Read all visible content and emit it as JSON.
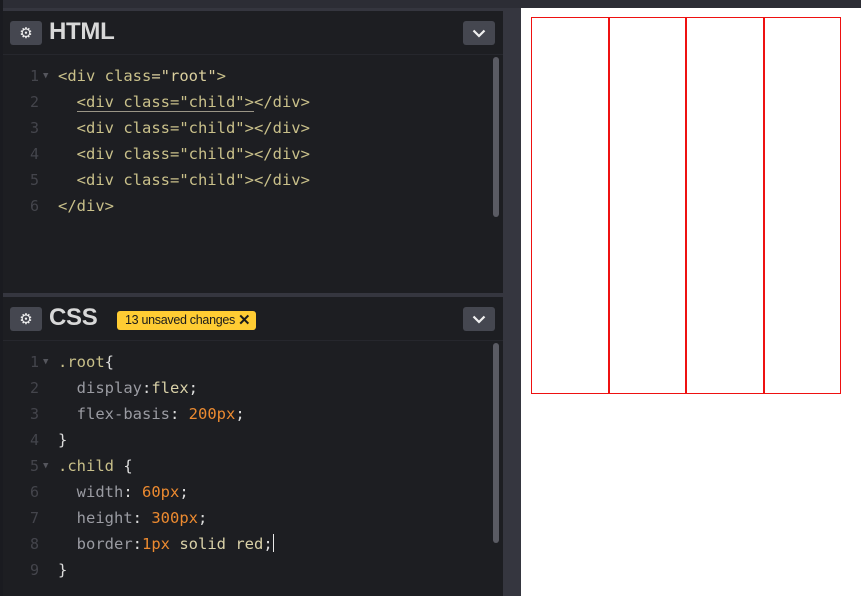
{
  "html_panel": {
    "title": "HTML",
    "settings_icon": "gear-icon",
    "collapse_icon": "chevron-down-icon",
    "lines": [
      {
        "n": "1",
        "tokens": [
          {
            "t": "<div ",
            "c": "t-tag"
          },
          {
            "t": "class",
            "c": "t-attr"
          },
          {
            "t": "=\"root\"",
            "c": "t-str"
          },
          {
            "t": ">",
            "c": "t-tag"
          }
        ]
      },
      {
        "n": "2",
        "tokens": [
          {
            "t": "  ",
            "c": "t-pun"
          },
          {
            "t": "<div class=\"child\">",
            "c": "t-tag underline"
          },
          {
            "t": "</div>",
            "c": "t-tag"
          }
        ]
      },
      {
        "n": "3",
        "tokens": [
          {
            "t": "  <div class=\"child\"></div>",
            "c": "t-tag"
          }
        ]
      },
      {
        "n": "4",
        "tokens": [
          {
            "t": "  <div class=\"child\"></div>",
            "c": "t-tag"
          }
        ]
      },
      {
        "n": "5",
        "tokens": [
          {
            "t": "  <div class=\"child\"></div>",
            "c": "t-tag"
          }
        ]
      },
      {
        "n": "6",
        "tokens": [
          {
            "t": "</div>",
            "c": "t-tag"
          }
        ]
      }
    ]
  },
  "css_panel": {
    "title": "CSS",
    "settings_icon": "gear-icon",
    "collapse_icon": "chevron-down-icon",
    "unsaved_badge": "13 unsaved changes",
    "badge_close": "✕",
    "lines": [
      {
        "n": "1",
        "tokens": [
          {
            "t": ".root",
            "c": "t-sel"
          },
          {
            "t": "{",
            "c": "t-pun"
          }
        ]
      },
      {
        "n": "2",
        "tokens": [
          {
            "t": "  display",
            "c": "t-prop"
          },
          {
            "t": ":",
            "c": "t-pun"
          },
          {
            "t": "flex",
            "c": "t-kw"
          },
          {
            "t": ";",
            "c": "t-pun"
          }
        ]
      },
      {
        "n": "3",
        "tokens": [
          {
            "t": "  flex-basis",
            "c": "t-prop"
          },
          {
            "t": ": ",
            "c": "t-pun"
          },
          {
            "t": "200px",
            "c": "t-num"
          },
          {
            "t": ";",
            "c": "t-pun"
          }
        ]
      },
      {
        "n": "4",
        "tokens": [
          {
            "t": "}",
            "c": "t-pun"
          }
        ]
      },
      {
        "n": "5",
        "tokens": [
          {
            "t": ".child ",
            "c": "t-sel"
          },
          {
            "t": "{",
            "c": "t-pun"
          }
        ]
      },
      {
        "n": "6",
        "tokens": [
          {
            "t": "  width",
            "c": "t-prop"
          },
          {
            "t": ": ",
            "c": "t-pun"
          },
          {
            "t": "60px",
            "c": "t-num"
          },
          {
            "t": ";",
            "c": "t-pun"
          }
        ]
      },
      {
        "n": "7",
        "tokens": [
          {
            "t": "  height",
            "c": "t-prop"
          },
          {
            "t": ": ",
            "c": "t-pun"
          },
          {
            "t": "300px",
            "c": "t-num"
          },
          {
            "t": ";",
            "c": "t-pun"
          }
        ]
      },
      {
        "n": "8",
        "tokens": [
          {
            "t": "  border",
            "c": "t-prop"
          },
          {
            "t": ":",
            "c": "t-pun"
          },
          {
            "t": "1px",
            "c": "t-num"
          },
          {
            "t": " solid red",
            "c": "t-kw"
          },
          {
            "t": ";",
            "c": "t-pun"
          }
        ]
      },
      {
        "n": "9",
        "tokens": [
          {
            "t": "}",
            "c": "t-pun"
          }
        ]
      }
    ]
  },
  "fold_marker": "▼",
  "colors": {
    "accent_badge": "#ffcc33",
    "child_border": "#ee1111"
  },
  "preview": {
    "child_count": 4
  }
}
